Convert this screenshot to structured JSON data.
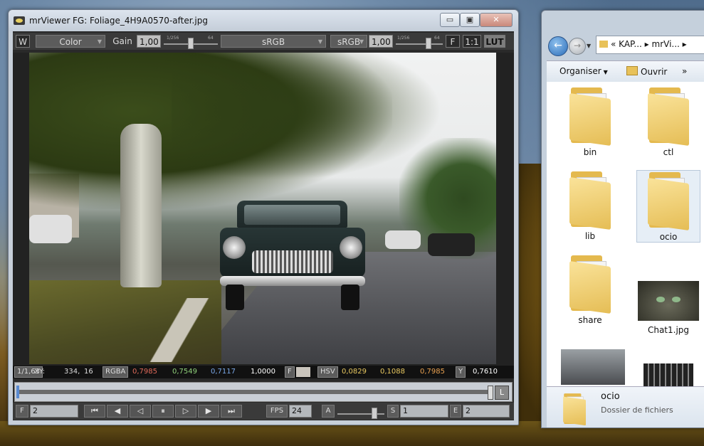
{
  "mrviewer": {
    "app_name": "mrViewer",
    "file_title": "FG: Foliage_4H9A0570-after.jpg",
    "win_minimize": "▭",
    "win_maximize": "▣",
    "win_close": "✕",
    "toolbar": {
      "w_label": "W",
      "channel": "Color",
      "gain_label": "Gain",
      "gain_value": "1,00",
      "gain_tick_min": "1/256",
      "gain_tick_max": "64",
      "input_colorspace": "sRGB",
      "display_label": "sRGB",
      "gamma_value": "1,00",
      "gamma_tick_min": "1/256",
      "gamma_tick_max": "64",
      "f_label": "F",
      "zoom_label": "1:1",
      "lut_label": "LUT"
    },
    "infobar": {
      "zoom": "1/1,63",
      "xy_label": "XY:",
      "x": "334,",
      "y": "16",
      "rgba_label": "RGBA",
      "r": "0,7985",
      "g": "0,7549",
      "b": "0,7117",
      "a": "1,0000",
      "f_label": "F",
      "hsv_label": "HSV",
      "h": "0,0829",
      "s": "0,1088",
      "v": "0,7985",
      "y_label": "Y",
      "luma": "0,7610"
    },
    "timeline": {
      "loop_label": "L"
    },
    "transport": {
      "frame_label": "F",
      "frame_value": "2",
      "fps_label": "FPS",
      "fps_value": "24",
      "a_label": "A",
      "s_label": "S",
      "s_value": "1",
      "e_label": "E",
      "e_value": "2",
      "btn_first": "⏮",
      "btn_prev": "◀",
      "btn_play_back": "◁",
      "btn_stop": "⏸",
      "btn_play_fwd": "▷",
      "btn_next": "▶",
      "btn_last": "⏭"
    }
  },
  "explorer": {
    "address_prefix": "«",
    "address_path": "KAP... ▸ mrVi... ▸",
    "organise": "Organiser",
    "open": "Ouvrir",
    "more": "»",
    "items": [
      {
        "label": "bin"
      },
      {
        "label": "ctl"
      },
      {
        "label": "lib"
      },
      {
        "label": "ocio"
      },
      {
        "label": "share"
      },
      {
        "label": "Chat1.jpg"
      }
    ],
    "details": {
      "name": "ocio",
      "type": "Dossier de fichiers"
    }
  }
}
